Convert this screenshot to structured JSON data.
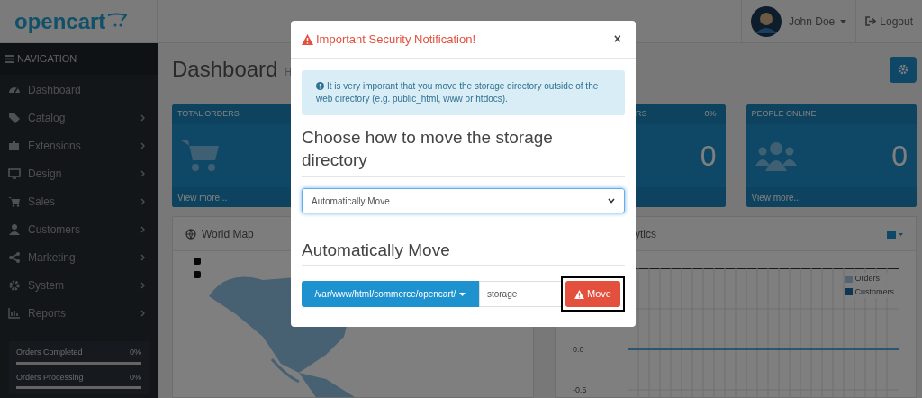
{
  "header": {
    "logo": "opencart",
    "user": "John Doe",
    "logout": "Logout"
  },
  "sidebar": {
    "title": "NAVIGATION",
    "items": [
      {
        "label": "Dashboard",
        "expandable": false
      },
      {
        "label": "Catalog",
        "expandable": true
      },
      {
        "label": "Extensions",
        "expandable": true
      },
      {
        "label": "Design",
        "expandable": true
      },
      {
        "label": "Sales",
        "expandable": true
      },
      {
        "label": "Customers",
        "expandable": true
      },
      {
        "label": "Marketing",
        "expandable": true
      },
      {
        "label": "System",
        "expandable": true
      },
      {
        "label": "Reports",
        "expandable": true
      }
    ],
    "progress": [
      {
        "label": "Orders Completed",
        "reading": "0%",
        "level": 0
      },
      {
        "label": "Orders Processing",
        "reading": "0%",
        "level": 0
      }
    ]
  },
  "page": {
    "title": "Dashboard",
    "breadcrumb": "H"
  },
  "stat_cards": [
    {
      "kind": "cart",
      "label": "TOTAL ORDERS",
      "link": "View more..."
    },
    {
      "kind": "hidden"
    },
    {
      "kind": "partial",
      "label": "RS",
      "reading": "0%",
      "value": "0"
    },
    {
      "kind": "people",
      "label": "PEOPLE ONLINE",
      "value": "0",
      "link": "View more..."
    }
  ],
  "panels": {
    "map": {
      "title": "World Map"
    },
    "analytics": {
      "title": "ytics",
      "legend": [
        "Orders",
        "Customers"
      ],
      "axis_labels": [
        "0.0",
        "-0.5"
      ]
    }
  },
  "modal": {
    "title": "Important Security Notification!",
    "close": "×",
    "alert": "It is very imporant that you move the storage directory outside of the web directory (e.g. public_html, www or htdocs).",
    "heading": "Choose how to move the storage directory",
    "select": "Automatically Move",
    "subheading": "Automatically Move",
    "path": "/var/www/html/commerce/opencart/",
    "folder": "storage",
    "button": "Move",
    "highlighted": true
  }
}
